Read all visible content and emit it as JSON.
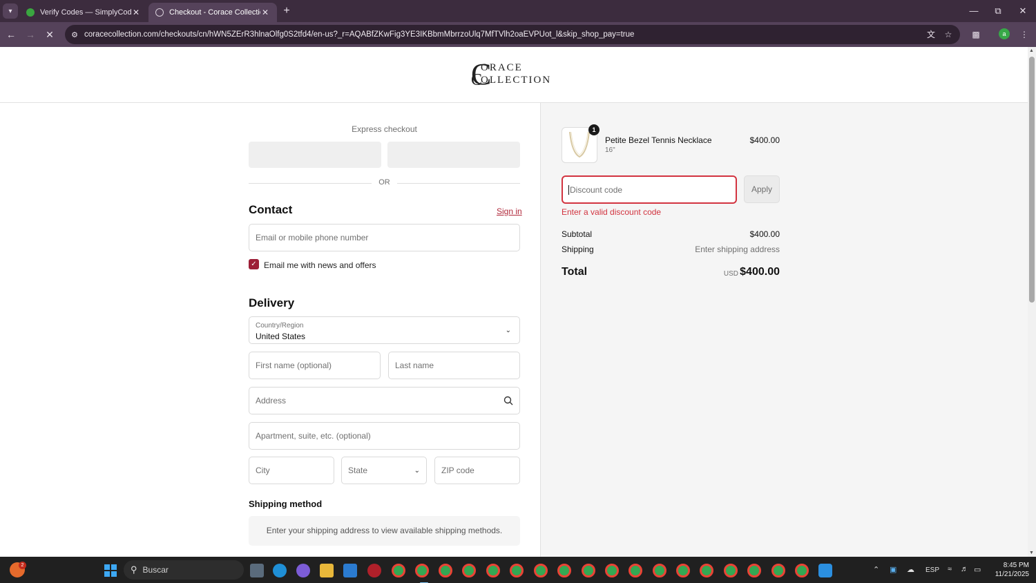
{
  "browser": {
    "tabs": [
      {
        "title": "Verify Codes — SimplyCodes",
        "active": false
      },
      {
        "title": "Checkout - Corace Collection",
        "active": true
      }
    ],
    "new_tab": "+",
    "url": "coracecollection.com/checkouts/cn/hWN5ZErR3hlnaOlfg0S2tfd4/en-us?_r=AQABfZKwFig3YE3IKBbmMbrrzoUlq7MfTVlh2oaEVPUot_l&skip_shop_pay=true",
    "profile_initial": "a"
  },
  "header": {
    "logo_line1": "ORACE",
    "logo_line2": "OLLECTION",
    "logo_initial": "C"
  },
  "checkout": {
    "express_title": "Express checkout",
    "or_label": "OR",
    "contact": {
      "heading": "Contact",
      "sign_in": "Sign in",
      "email_placeholder": "Email or mobile phone number",
      "newsletter_label": "Email me with news and offers",
      "newsletter_checked": true
    },
    "delivery": {
      "heading": "Delivery",
      "country_label": "Country/Region",
      "country_value": "United States",
      "first_name_placeholder": "First name (optional)",
      "last_name_placeholder": "Last name",
      "address_placeholder": "Address",
      "apartment_placeholder": "Apartment, suite, etc. (optional)",
      "city_placeholder": "City",
      "state_placeholder": "State",
      "zip_placeholder": "ZIP code"
    },
    "shipping_method": {
      "heading": "Shipping method",
      "message": "Enter your shipping address to view available shipping methods."
    }
  },
  "summary": {
    "item": {
      "quantity": "1",
      "name": "Petite Bezel Tennis Necklace",
      "variant": "16\"",
      "price": "$400.00"
    },
    "discount_placeholder": "Discount code",
    "apply_label": "Apply",
    "discount_error": "Enter a valid discount code",
    "subtotal_label": "Subtotal",
    "subtotal_value": "$400.00",
    "shipping_label": "Shipping",
    "shipping_value": "Enter shipping address",
    "total_label": "Total",
    "currency": "USD",
    "total_value": "$400.00",
    "error_color": "#d2333f",
    "brand_color": "#9d1f37"
  },
  "taskbar": {
    "widget_badge": "2",
    "search_placeholder": "Buscar",
    "language": "ESP",
    "time": "8:45 PM",
    "date": "11/21/2025"
  }
}
